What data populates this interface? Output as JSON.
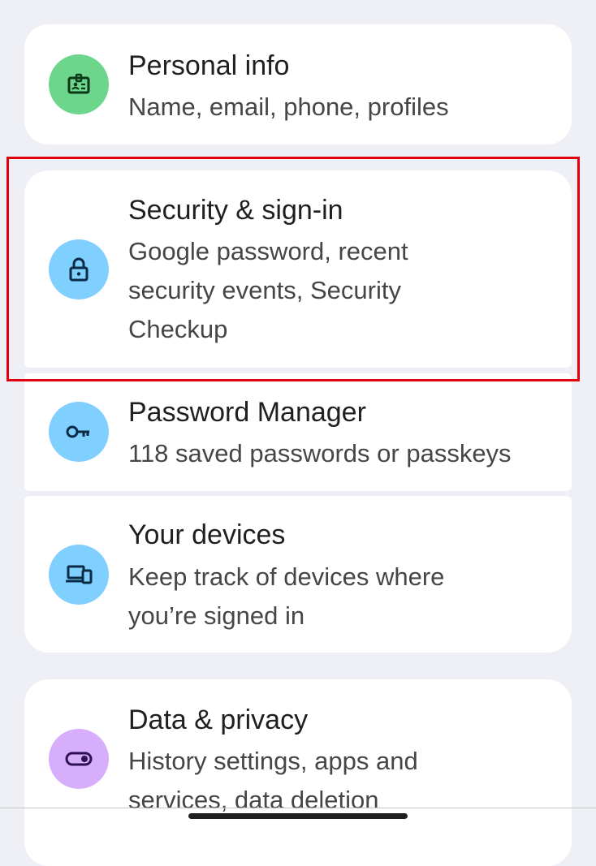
{
  "items": [
    {
      "title": "Personal info",
      "subtitle": "Name, email, phone, profiles",
      "icon": "badge-icon",
      "icon_color": "#6dd58c"
    },
    {
      "title": "Security & sign-in",
      "subtitle": "Google password, recent security events, Security Checkup",
      "icon": "lock-icon",
      "icon_color": "#7fcfff"
    },
    {
      "title": "Password Manager",
      "subtitle": "118 saved passwords or passkeys",
      "icon": "key-icon",
      "icon_color": "#7fcfff"
    },
    {
      "title": "Your devices",
      "subtitle": "Keep track of devices where you’re signed in",
      "icon": "devices-icon",
      "icon_color": "#7fcfff"
    },
    {
      "title": "Data & privacy",
      "subtitle": "History settings, apps and services, data deletion",
      "icon": "toggle-icon",
      "icon_color": "#d7aefb"
    }
  ],
  "colors": {
    "background": "#eef0f6",
    "card": "#ffffff",
    "highlight": "#e2000f",
    "title_text": "#1f1f1f",
    "subtitle_text": "#444746"
  }
}
